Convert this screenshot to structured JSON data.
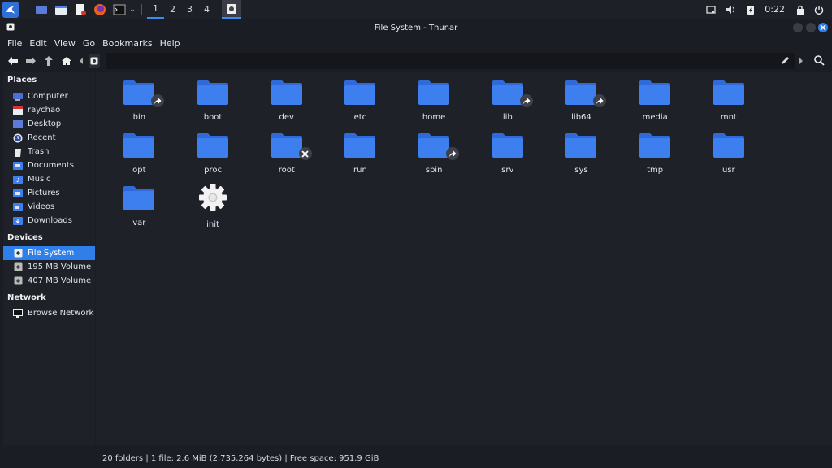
{
  "taskbar": {
    "workspaces": [
      "1",
      "2",
      "3",
      "4"
    ],
    "clock": "0:22"
  },
  "window": {
    "title": "File System - Thunar"
  },
  "menu": [
    "File",
    "Edit",
    "View",
    "Go",
    "Bookmarks",
    "Help"
  ],
  "sidebar": {
    "places_heading": "Places",
    "places": [
      "Computer",
      "raychao",
      "Desktop",
      "Recent",
      "Trash",
      "Documents",
      "Music",
      "Pictures",
      "Videos",
      "Downloads"
    ],
    "devices_heading": "Devices",
    "devices": [
      "File System",
      "195 MB Volume",
      "407 MB Volume"
    ],
    "network_heading": "Network",
    "network": [
      "Browse Network"
    ]
  },
  "files": [
    {
      "name": "bin",
      "emblem": "link"
    },
    {
      "name": "boot",
      "emblem": ""
    },
    {
      "name": "dev",
      "emblem": ""
    },
    {
      "name": "etc",
      "emblem": ""
    },
    {
      "name": "home",
      "emblem": ""
    },
    {
      "name": "lib",
      "emblem": "link"
    },
    {
      "name": "lib64",
      "emblem": "link"
    },
    {
      "name": "media",
      "emblem": ""
    },
    {
      "name": "mnt",
      "emblem": ""
    },
    {
      "name": "opt",
      "emblem": ""
    },
    {
      "name": "proc",
      "emblem": ""
    },
    {
      "name": "root",
      "emblem": "no-access"
    },
    {
      "name": "run",
      "emblem": ""
    },
    {
      "name": "sbin",
      "emblem": "link"
    },
    {
      "name": "srv",
      "emblem": ""
    },
    {
      "name": "sys",
      "emblem": ""
    },
    {
      "name": "tmp",
      "emblem": ""
    },
    {
      "name": "usr",
      "emblem": ""
    },
    {
      "name": "var",
      "emblem": ""
    },
    {
      "name": "init",
      "emblem": "",
      "type": "executable"
    }
  ],
  "status": "20 folders  |  1 file: 2.6 MiB (2,735,264 bytes)  |  Free space: 951.9 GiB",
  "colors": {
    "accent": "#2f7fe8",
    "folder": "#3d7fef",
    "folder_tab": "#2f6ad8",
    "background": "#1f2129"
  }
}
